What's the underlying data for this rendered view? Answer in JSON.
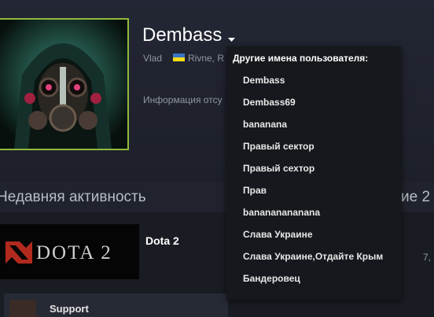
{
  "profile": {
    "persona_name": "Dembass",
    "real_name": "Vlad",
    "location": "Rivne, R",
    "info": "Информация отсу"
  },
  "aliases": {
    "header": "Другие имена пользователя:",
    "items": [
      "Dembass",
      "Dembass69",
      "bananana",
      "Правый сектор",
      "Правый сехтор",
      "Прав",
      "banananananana",
      "Слава Украине",
      "Слава Украине,Отдайте Крым",
      "Бандеровец"
    ]
  },
  "activity": {
    "title": "Недавняя активность",
    "right_title": "ие 2",
    "right_number": "7,",
    "game": {
      "name": "Dota 2",
      "banner_text": "DOTA 2"
    },
    "badge_label": "Support"
  },
  "colors": {
    "avatar_border": "#90ba3c",
    "dropdown_bg": "#16181d",
    "flag_blue": "#3a75c4",
    "flag_yellow": "#f9dd16"
  }
}
